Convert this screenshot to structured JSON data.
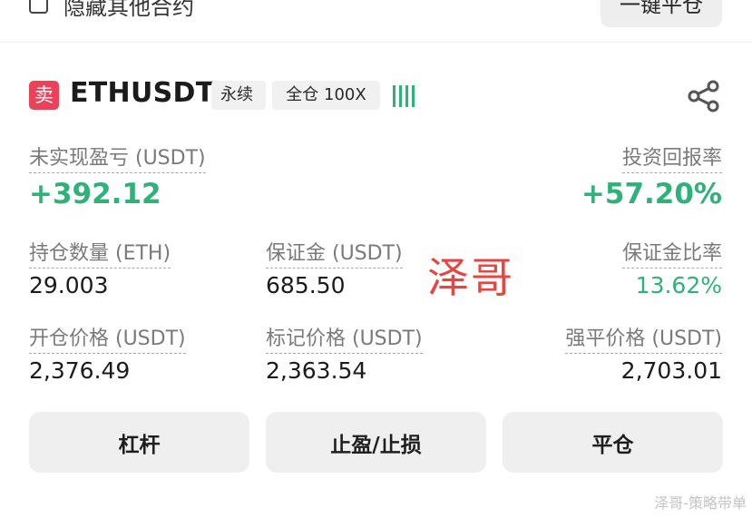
{
  "top": {
    "hide_others_label": "隐藏其他合约",
    "close_all_button": "一键平仓"
  },
  "position": {
    "side_badge": "卖",
    "symbol": "ETHUSDT",
    "contract_type": "永续",
    "margin_mode": "全仓 100X",
    "colors": {
      "sell": "#e94359",
      "profit": "#2fb27a"
    }
  },
  "stats": {
    "unrealized_pnl_label": "未实现盈亏 (USDT)",
    "unrealized_pnl_value": "+392.12",
    "roi_label": "投资回报率",
    "roi_value": "+57.20%",
    "size_label": "持仓数量 (ETH)",
    "size_value": "29.003",
    "margin_label": "保证金 (USDT)",
    "margin_value": "685.50",
    "margin_ratio_label": "保证金比率",
    "margin_ratio_value": "13.62%",
    "entry_price_label": "开仓价格 (USDT)",
    "entry_price_value": "2,376.49",
    "mark_price_label": "标记价格 (USDT)",
    "mark_price_value": "2,363.54",
    "liq_price_label": "强平价格 (USDT)",
    "liq_price_value": "2,703.01"
  },
  "overlay": {
    "watermark": "泽哥"
  },
  "buttons": {
    "leverage": "杠杆",
    "tp_sl": "止盈/止损",
    "close": "平仓"
  },
  "footer": {
    "source_watermark": "泽哥-策略带单"
  },
  "icons": {
    "share": "share-icon",
    "signal": "signal-bars-icon"
  }
}
